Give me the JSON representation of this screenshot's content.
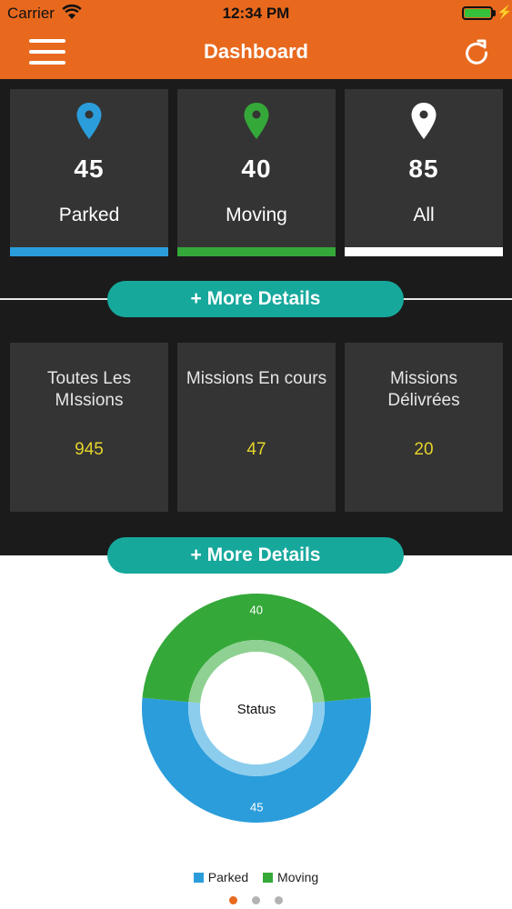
{
  "status_bar": {
    "carrier": "Carrier",
    "time": "12:34 PM"
  },
  "nav": {
    "title": "Dashboard"
  },
  "stats": [
    {
      "value": "45",
      "label": "Parked",
      "color": "#2b9ddb"
    },
    {
      "value": "40",
      "label": "Moving",
      "color": "#35a83a"
    },
    {
      "value": "85",
      "label": "All",
      "color": "#ffffff"
    }
  ],
  "more_details_label": "+ More Details",
  "missions": [
    {
      "label": "Toutes Les MIssions",
      "value": "945"
    },
    {
      "label": "Missions En cours",
      "value": "47"
    },
    {
      "label": "Missions Délivrées",
      "value": "20"
    }
  ],
  "chart_data": {
    "type": "pie",
    "title": "",
    "center_label": "Status",
    "categories": [
      "Parked",
      "Moving"
    ],
    "values": [
      45,
      40
    ],
    "colors": [
      "#2b9ddb",
      "#35a83a"
    ],
    "legend": "bottom"
  },
  "pager": {
    "pages": 3,
    "active": 0
  },
  "colors": {
    "accent": "#e8691e",
    "button": "#17a89c",
    "value_yellow": "#e5d42a"
  }
}
